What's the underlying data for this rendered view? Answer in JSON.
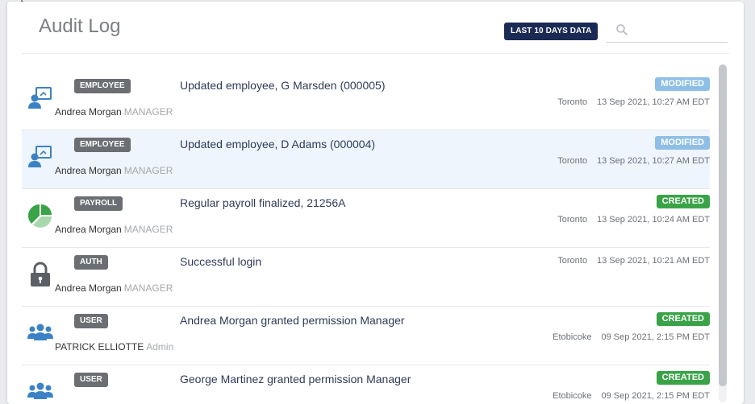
{
  "header": {
    "title": "Audit Log",
    "range_badge": "LAST 10 DAYS DATA",
    "search_placeholder": ""
  },
  "colors": {
    "badge_dark": "#1b2a55",
    "modified": "#8fbfe6",
    "created": "#3aa348",
    "category": "#6b6e73",
    "icon_blue": "#3b82c4",
    "icon_green": "#3aa348",
    "icon_gray": "#5c6066"
  },
  "rows": [
    {
      "icon": "employee-icon",
      "category": "EMPLOYEE",
      "description": "Updated employee, G Marsden (000005)",
      "user": "Andrea Morgan",
      "role": "MANAGER",
      "status": "MODIFIED",
      "location": "Toronto",
      "timestamp": "13 Sep 2021, 10:27 AM EDT"
    },
    {
      "icon": "employee-icon",
      "category": "EMPLOYEE",
      "description": "Updated employee, D Adams (000004)",
      "user": "Andrea Morgan",
      "role": "MANAGER",
      "status": "MODIFIED",
      "location": "Toronto",
      "timestamp": "13 Sep 2021, 10:27 AM EDT"
    },
    {
      "icon": "payroll-pie-icon",
      "category": "PAYROLL",
      "description": "Regular payroll finalized, 21256A",
      "user": "Andrea Morgan",
      "role": "MANAGER",
      "status": "CREATED",
      "location": "Toronto",
      "timestamp": "13 Sep 2021, 10:24 AM EDT"
    },
    {
      "icon": "lock-icon",
      "category": "AUTH",
      "description": "Successful login",
      "user": "Andrea Morgan",
      "role": "MANAGER",
      "status": "",
      "location": "Toronto",
      "timestamp": "13 Sep 2021, 10:21 AM EDT"
    },
    {
      "icon": "users-group-icon",
      "category": "USER",
      "description": "Andrea Morgan granted permission Manager",
      "user": "PATRICK ELLIOTTE",
      "role": "Admin",
      "status": "CREATED",
      "location": "Etobicoke",
      "timestamp": "09 Sep 2021, 2:15 PM EDT"
    },
    {
      "icon": "users-group-icon",
      "category": "USER",
      "description": "George Martinez granted permission Manager",
      "user": "",
      "role": "",
      "status": "CREATED",
      "location": "Etobicoke",
      "timestamp": "09 Sep 2021, 2:15 PM EDT"
    }
  ]
}
